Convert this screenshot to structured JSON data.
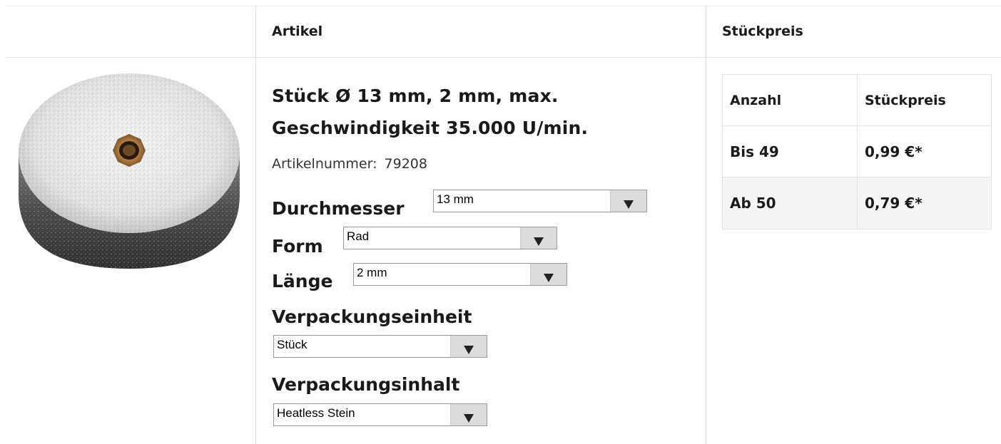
{
  "header": {
    "col_artikel": "Artikel",
    "col_stueckpreis": "Stückpreis"
  },
  "product": {
    "title_line1": "Stück Ø 13 mm, 2 mm, max.",
    "title_line2": "Geschwindigkeit 35.000 U/min.",
    "artnr_label": "Artikelnummer:",
    "artnr_value": "79208",
    "image_icon": "grinding-wheel-image"
  },
  "options": {
    "durchmesser": {
      "label": "Durchmesser",
      "value": "13 mm"
    },
    "form": {
      "label": "Form",
      "value": "Rad"
    },
    "laenge": {
      "label": "Länge",
      "value": "2 mm"
    },
    "verpackungseinheit": {
      "label": "Verpackungseinheit",
      "value": "Stück"
    },
    "verpackungsinhalt": {
      "label": "Verpackungsinhalt",
      "value": "Heatless Stein"
    }
  },
  "price_table": {
    "head": {
      "anzahl": "Anzahl",
      "stueckpreis": "Stückpreis"
    },
    "rows": [
      {
        "anzahl": "Bis 49",
        "preis": "0,99 €*"
      },
      {
        "anzahl": "Ab 50",
        "preis": "0,79 €*"
      }
    ]
  },
  "colors": {
    "border": "#dcdcdc",
    "row_alt": "#f5f5f5",
    "select_arrow_bg": "#dcdcdc"
  }
}
